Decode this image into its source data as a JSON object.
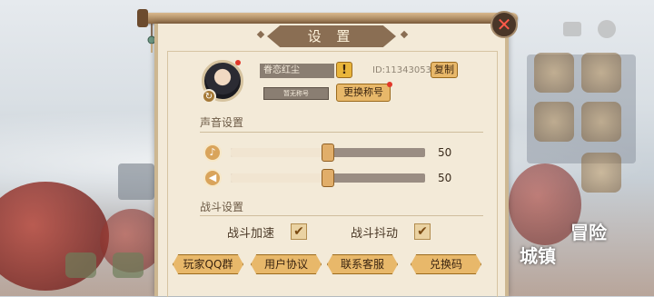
{
  "dialog": {
    "title": "设 置",
    "close_glyph": "✕"
  },
  "profile": {
    "name": "眷恋红尘",
    "edit_glyph": "!",
    "uid": "ID:11343053",
    "copy_label": "复制",
    "honor_placeholder": "暂无称号",
    "change_honor_label": "更换称号"
  },
  "sound": {
    "section_title": "声音设置",
    "music": {
      "icon": "music-note-icon",
      "glyph": "♪",
      "value": "50",
      "level": 0.5
    },
    "effects": {
      "icon": "speaker-icon",
      "glyph": "◀",
      "value": "50",
      "level": 0.5
    }
  },
  "battle": {
    "section_title": "战斗设置",
    "speedup": {
      "label": "战斗加速",
      "checked": true
    },
    "shake": {
      "label": "战斗抖动",
      "checked": true
    },
    "check_glyph": "✔"
  },
  "buttons": {
    "qq_group": "玩家QQ群",
    "agreement": "用户协议",
    "support": "联系客服",
    "redeem": "兑换码"
  },
  "background": {
    "side_labels": [
      "冒险",
      "城镇"
    ]
  },
  "colors": {
    "accent": "#e8b86a",
    "panel": "#f3ead8",
    "badge_red": "#e2382a"
  }
}
